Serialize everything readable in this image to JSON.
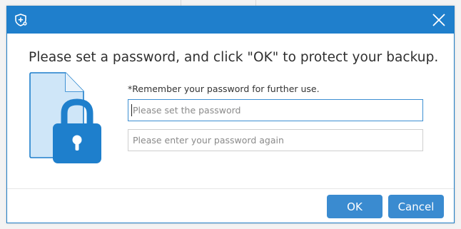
{
  "dialog": {
    "app_icon": "shield-plus-icon",
    "close_icon": "close-icon",
    "heading": "Please set a password, and click \"OK\" to protect your backup.",
    "illustration_icon": "locked-document-icon",
    "hint": "*Remember your password for further use.",
    "password_field": {
      "value": "",
      "placeholder": "Please set the password"
    },
    "confirm_field": {
      "value": "",
      "placeholder": "Please enter your password again"
    },
    "ok_label": "OK",
    "cancel_label": "Cancel"
  },
  "colors": {
    "titlebar": "#1f7fcc",
    "button": "#3a8bd0",
    "illustration_doc": "#cfe6f8",
    "illustration_lock": "#1e7fcc"
  }
}
